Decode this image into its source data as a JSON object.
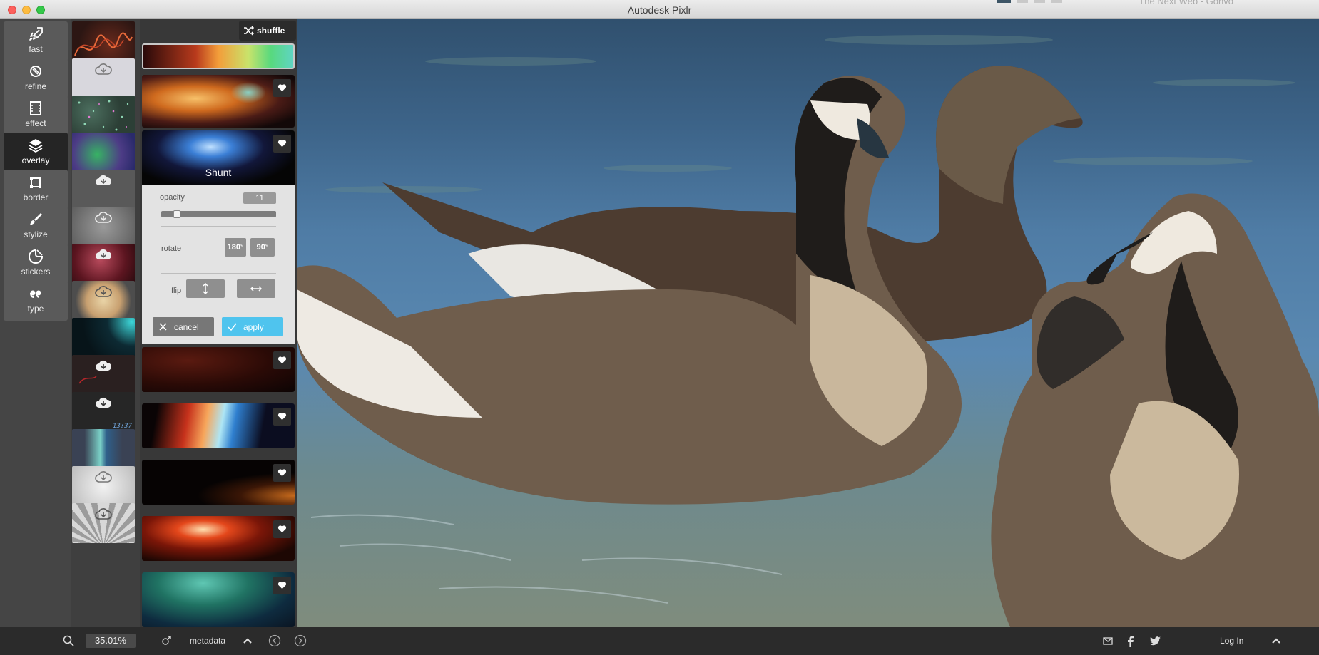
{
  "window": {
    "title": "Autodesk Pixlr",
    "background_window_title": "The Next Web - Gonvo"
  },
  "tools": [
    {
      "label": "fast",
      "icon": "rocket-icon"
    },
    {
      "label": "refine",
      "icon": "refine-icon"
    },
    {
      "label": "effect",
      "icon": "film-icon"
    },
    {
      "label": "overlay",
      "icon": "layers-icon",
      "active": true
    },
    {
      "label": "border",
      "icon": "border-frame-icon"
    },
    {
      "label": "stylize",
      "icon": "brush-icon"
    },
    {
      "label": "stickers",
      "icon": "sticker-icon"
    },
    {
      "label": "type",
      "icon": "quote-icon"
    }
  ],
  "thumbs_time_text": "13:37",
  "overlay_list": {
    "shuffle_label": "shuffle",
    "selected_name": "Shunt"
  },
  "adjust_panel": {
    "opacity_label": "opacity",
    "opacity_value": "11",
    "opacity_fraction": 0.11,
    "rotate_label": "rotate",
    "rotate_180": "180°",
    "rotate_90": "90°",
    "flip_label": "flip",
    "cancel_label": "cancel",
    "apply_label": "apply"
  },
  "bottom_bar": {
    "zoom_value": "35.01%",
    "metadata_label": "metadata",
    "login_label": "Log In"
  },
  "colors": {
    "accent": "#4fc4ee",
    "panel": "#e3e3e3",
    "toolbar": "#2b2b2b"
  }
}
